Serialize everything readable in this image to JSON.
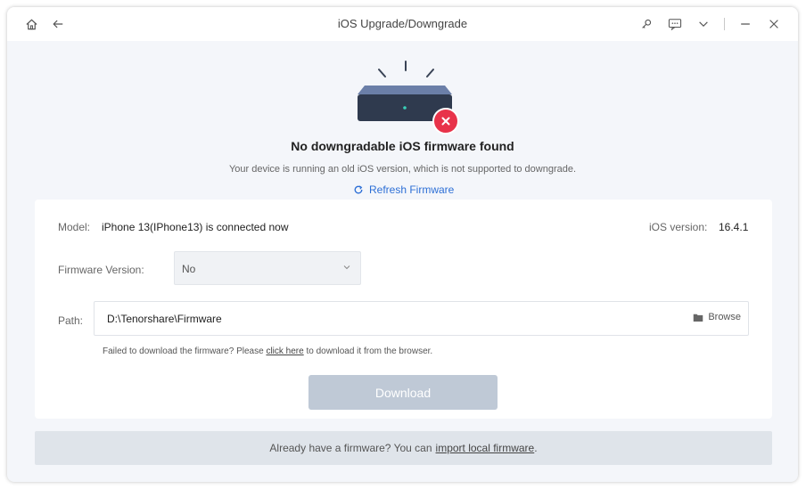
{
  "titlebar": {
    "title": "iOS Upgrade/Downgrade",
    "icons": [
      "home-icon",
      "back-arrow-icon",
      "key-icon",
      "feedback-icon",
      "dropdown-chevron-icon",
      "minimize-icon",
      "close-icon"
    ]
  },
  "hero": {
    "heading": "No downgradable iOS firmware found",
    "subtext": "Your device is running an old iOS version, which is not supported to downgrade.",
    "refresh_label": "Refresh Firmware",
    "error_badge_color": "#e8334a",
    "device_color": "#2f3a4e"
  },
  "panel": {
    "model_label": "Model:",
    "model_value": "iPhone 13(IPhone13) is connected now",
    "ios_label": "iOS version:",
    "ios_value": "16.4.1",
    "firmware_label": "Firmware Version:",
    "firmware_value": "No",
    "path_label": "Path:",
    "path_value": "D:\\Tenorshare\\Firmware",
    "browse_label": "Browse",
    "hint_prefix": "Failed to download the firmware? Please",
    "hint_link": "click here",
    "hint_suffix": "to download it from the browser.",
    "download_label": "Download",
    "download_color": "#bfc9d6"
  },
  "footer": {
    "prefix": "Already have a firmware? You can",
    "link": "import local firmware",
    "suffix": "."
  },
  "accent_color": "#2d6fd6"
}
